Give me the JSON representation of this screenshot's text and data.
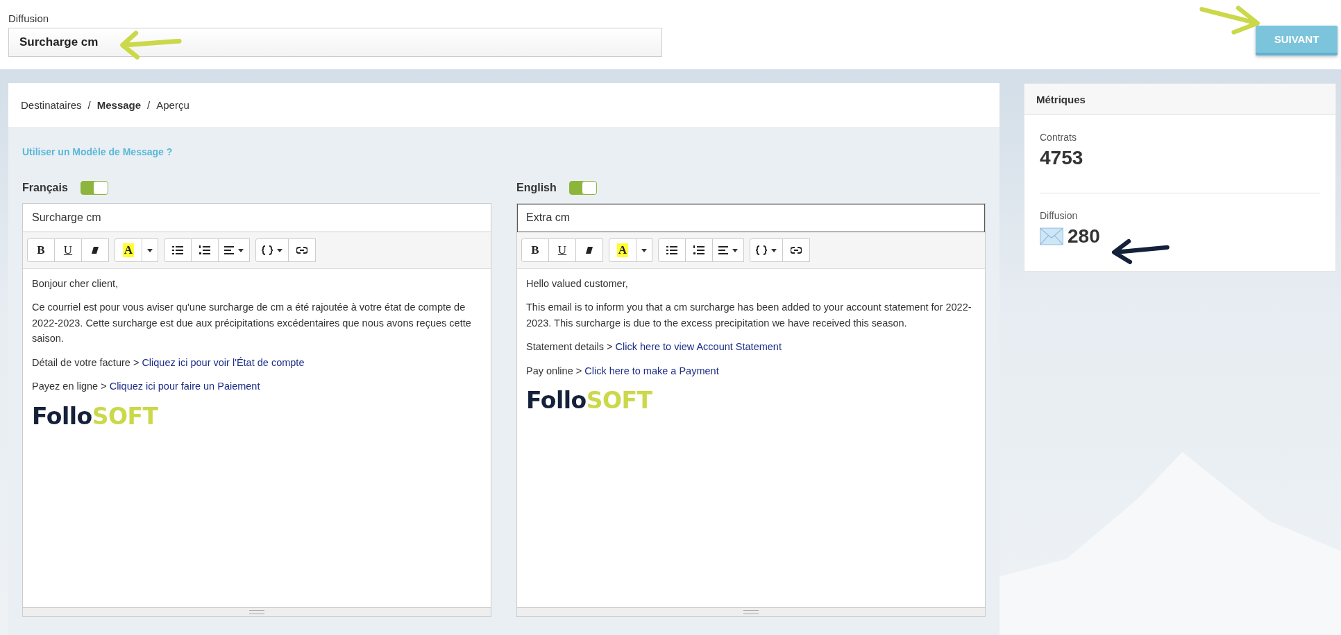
{
  "diffusion": {
    "label": "Diffusion",
    "value": "Surcharge cm"
  },
  "next_button": "SUIVANT",
  "breadcrumb": {
    "items": [
      {
        "label": "Destinataires",
        "selected": false
      },
      {
        "label": "Message",
        "selected": true
      },
      {
        "label": "Aperçu",
        "selected": false
      }
    ],
    "separators": [
      "/",
      "/"
    ]
  },
  "template_link": "Utiliser un Modèle de Message ?",
  "editors": [
    {
      "language": "Français",
      "enabled": true,
      "subject": "Surcharge cm",
      "focused": false,
      "toolbar": [
        {
          "kind": "bold",
          "label": "B",
          "group_start": true
        },
        {
          "kind": "underline",
          "label": "U",
          "group_start": false
        },
        {
          "kind": "eraser",
          "group_start": false
        },
        {
          "kind": "color",
          "label": "A",
          "group_start": true
        },
        {
          "kind": "caret",
          "group_start": false
        },
        {
          "kind": "bullets",
          "group_start": true
        },
        {
          "kind": "numbers",
          "group_start": false
        },
        {
          "kind": "align",
          "group_start": false
        },
        {
          "kind": "code",
          "group_start": true
        },
        {
          "kind": "link",
          "group_start": false
        }
      ],
      "paragraphs": [
        {
          "text": "Bonjour cher client,"
        },
        {
          "text": "Ce courriel est pour vous aviser qu'une surcharge de cm a été rajoutée à votre état de compte de 2022-2023. Cette surcharge est due aux précipitations excédentaires que nous avons reçues cette saison."
        },
        {
          "text": "Détail de votre facture > ",
          "link": "Cliquez ici pour voir l'État de compte"
        },
        {
          "text": "Payez en ligne > ",
          "link": "Cliquez ici pour faire un Paiement"
        }
      ],
      "logo": {
        "dark": "Follo",
        "accent": "SOFT"
      }
    },
    {
      "language": "English",
      "enabled": true,
      "subject": "Extra cm",
      "focused": true,
      "toolbar": [
        {
          "kind": "bold",
          "label": "B",
          "group_start": true
        },
        {
          "kind": "underline",
          "label": "U",
          "group_start": false
        },
        {
          "kind": "eraser",
          "group_start": false
        },
        {
          "kind": "color",
          "label": "A",
          "group_start": true
        },
        {
          "kind": "caret",
          "group_start": false
        },
        {
          "kind": "bullets",
          "group_start": true
        },
        {
          "kind": "numbers",
          "group_start": false
        },
        {
          "kind": "align",
          "group_start": false
        },
        {
          "kind": "code",
          "group_start": true
        },
        {
          "kind": "link",
          "group_start": false
        }
      ],
      "paragraphs": [
        {
          "text": "Hello valued customer,"
        },
        {
          "text": "This email is to inform you that a cm surcharge has been added to your account statement for 2022-2023. This surcharge is due to the excess precipitation we have received this season."
        },
        {
          "text": "Statement details > ",
          "link": "Click here to view Account Statement"
        },
        {
          "text": "Pay online > ",
          "link": "Click here to make a Payment"
        }
      ],
      "logo": {
        "dark": "Follo",
        "accent": "SOFT"
      }
    }
  ],
  "metrics": {
    "title": "Métriques",
    "items": [
      {
        "kind": "plain",
        "label": "Contrats",
        "value": "4753"
      },
      {
        "kind": "email",
        "label": "Diffusion",
        "value": "280"
      }
    ]
  }
}
